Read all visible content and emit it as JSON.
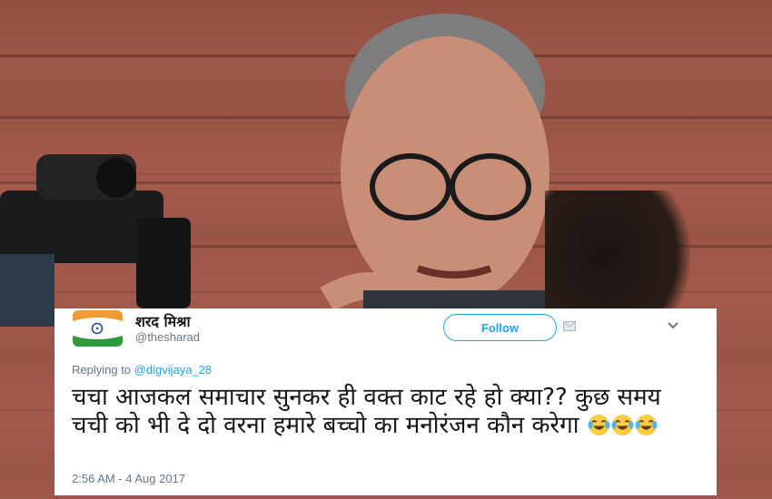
{
  "tweet": {
    "display_name": "शरद मिश्रा",
    "handle": "@thesharad",
    "follow_label": "Follow",
    "replying_prefix": "Replying to ",
    "replying_to": "@digvijaya_28",
    "text": "चचा आजकल समाचार सुनकर ही वक्त काट रहे हो क्या?? कुछ समय चची को भी दे दो वरना हमारे बच्चो का मनोरंजन कौन करेगा",
    "emojis": [
      "laughing-tears",
      "laughing-tears",
      "laughing-tears"
    ],
    "timestamp": "2:56 AM - 4 Aug 2017"
  },
  "colors": {
    "accent": "#1da1f2",
    "text_secondary": "#657786",
    "text_primary": "#14171a"
  },
  "icons": [
    "indian-flag-avatar",
    "direct-message-icon",
    "chevron-down-icon",
    "tears-of-joy-emoji"
  ]
}
